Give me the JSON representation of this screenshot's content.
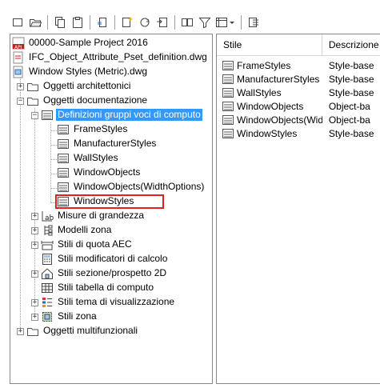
{
  "toolbar": {
    "buttons": [
      "new-icon",
      "open-icon",
      "copy-icon",
      "paste-icon",
      "purge-icon",
      "new-style-icon",
      "sync-icon",
      "import-icon",
      "filter-icon",
      "view-icon",
      "edit-icon"
    ]
  },
  "tree": {
    "project": "00000-Sample Project 2016",
    "drawing1": "IFC_Object_Attribute_Pset_definition.dwg",
    "drawing2": "Window Styles (Metric).dwg",
    "arch_objects": "Oggetti architettonici",
    "doc_objects": "Oggetti documentazione",
    "selected_folder": "Definizioni gruppi voci di computo",
    "children": [
      "FrameStyles",
      "ManufacturerStyles",
      "WallStyles",
      "WindowObjects",
      "WindowObjects(WidthOptions)",
      "WindowStyles"
    ],
    "other_items": [
      "Misure di grandezza",
      "Modelli zona",
      "Stili di quota AEC",
      "Stili modificatori di calcolo",
      "Stili sezione/prospetto 2D",
      "Stili tabella di computo",
      "Stili tema di visualizzazione",
      "Stili zona"
    ],
    "multi_objects": "Oggetti multifunzionali"
  },
  "list": {
    "col_style": "Stile",
    "col_desc": "Descrizione",
    "rows": [
      {
        "name": "FrameStyles",
        "desc": "Style-base"
      },
      {
        "name": "ManufacturerStyles",
        "desc": "Style-base"
      },
      {
        "name": "WallStyles",
        "desc": "Style-base"
      },
      {
        "name": "WindowObjects",
        "desc": "Object-ba"
      },
      {
        "name": "WindowObjects(Width...",
        "desc": "Object-ba"
      },
      {
        "name": "WindowStyles",
        "desc": "Style-base"
      }
    ]
  },
  "colors": {
    "selection": "#3399ff",
    "highlight": "#e0201e"
  }
}
